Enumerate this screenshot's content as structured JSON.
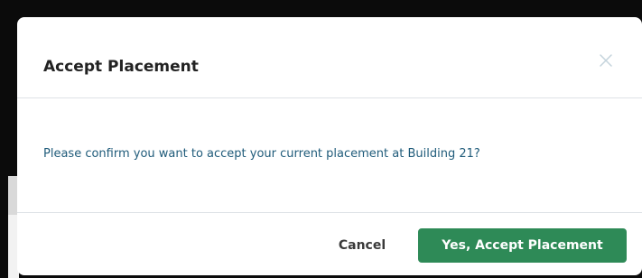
{
  "modal": {
    "title": "Accept Placement",
    "close_icon": "close-icon",
    "message": "Please confirm you want to accept your current placement at Building 21?",
    "cancel_label": "Cancel",
    "accept_label": "Yes, Accept Placement"
  },
  "colors": {
    "accent_green": "#2e8a57",
    "message_text": "#1f5b7a",
    "title_text": "#222222",
    "backdrop": "#0b0b0b"
  }
}
